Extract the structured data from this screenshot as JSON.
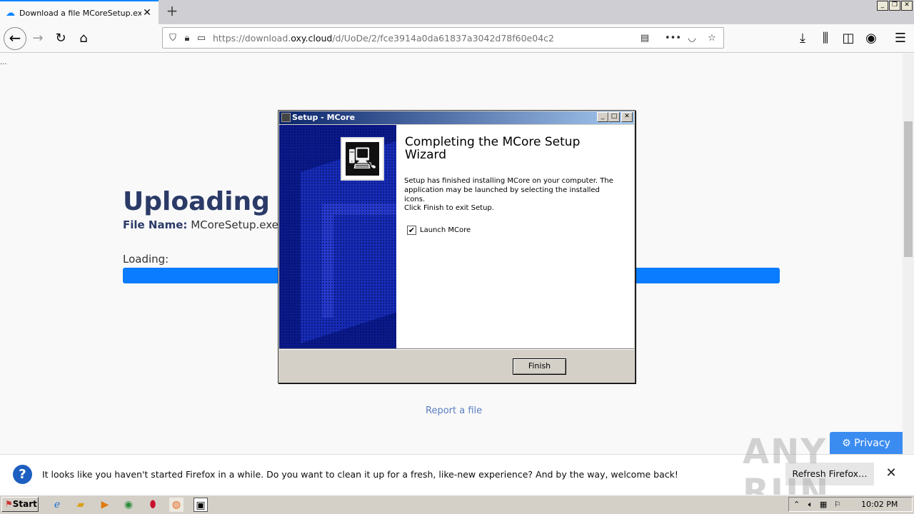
{
  "browser": {
    "tab_title": "Download a file MCoreSetup.exe o",
    "url_prefix": "https://download.",
    "url_domain": "oxy.cloud",
    "url_path": "/d/UoDe/2/fce3914a0da61837a3042d78f60e04c2"
  },
  "page": {
    "ellipsis": "...",
    "heading": "Uploading a",
    "file_name_label": "File Name:",
    "file_name": "MCoreSetup.exe",
    "loading_label": "Loading:",
    "report_link": "Report a file",
    "privacy_button": "Privacy"
  },
  "dialog": {
    "title": "Setup - MCore",
    "heading": "Completing the MCore Setup Wizard",
    "body1": "Setup has finished installing MCore on your computer. The application may be launched by selecting the installed icons.",
    "body2": "Click Finish to exit Setup.",
    "checkbox_label": "Launch MCore",
    "checkbox_checked": true,
    "finish_button": "Finish"
  },
  "notification": {
    "message": "It looks like you haven't started Firefox in a while. Do you want to clean it up for a fresh, like-new experience? And by the way, welcome back!",
    "refresh_button": "Refresh Firefox…"
  },
  "watermark": "ANY RUN",
  "taskbar": {
    "start_label": "Start",
    "clock": "10:02 PM"
  },
  "colors": {
    "accent": "#0a84ff",
    "progress": "#0a7cff",
    "heading": "#2b3a67",
    "dialog_title_start": "#0a246a"
  }
}
